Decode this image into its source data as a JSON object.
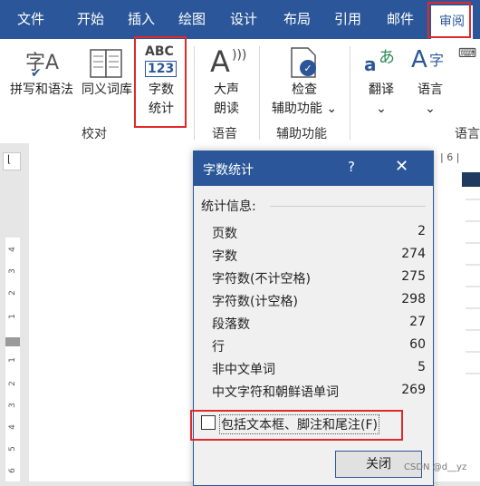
{
  "tabs": [
    {
      "label": "文件",
      "active": false
    },
    {
      "label": "开始",
      "active": false
    },
    {
      "label": "插入",
      "active": false
    },
    {
      "label": "绘图",
      "active": false
    },
    {
      "label": "设计",
      "active": false
    },
    {
      "label": "布局",
      "active": false
    },
    {
      "label": "引用",
      "active": false
    },
    {
      "label": "邮件",
      "active": false
    },
    {
      "label": "审阅",
      "active": true
    }
  ],
  "ribbon": {
    "spelling": "拼写和语法",
    "thesaurus": "同义词库",
    "wordcount_line1": "字数",
    "wordcount_line2": "统计",
    "wordcount_icon_top": "ABC",
    "wordcount_icon_bottom": "123",
    "spelling_icon": "字A",
    "readaloud_line1": "大声",
    "readaloud_line2": "朗读",
    "check_line1": "检查",
    "check_line2": "辅助功能",
    "translate": "翻译",
    "language": "语言",
    "group_proofing": "校对",
    "group_speech": "语音",
    "group_accessibility": "辅助功能",
    "group_language": "语言",
    "translate_icon": "あ",
    "language_icon": "字"
  },
  "dialog": {
    "title": "字数统计",
    "help": "?",
    "close_x": "✕",
    "stats_header": "统计信息:",
    "stats": [
      {
        "label": "页数",
        "value": "2"
      },
      {
        "label": "字数",
        "value": "274"
      },
      {
        "label": "字符数(不计空格)",
        "value": "275"
      },
      {
        "label": "字符数(计空格)",
        "value": "298"
      },
      {
        "label": "段落数",
        "value": "27"
      },
      {
        "label": "行",
        "value": "60"
      },
      {
        "label": "非中文单词",
        "value": "5"
      },
      {
        "label": "中文字符和朝鲜语单词",
        "value": "269"
      }
    ],
    "checkbox_label": "包括文本框、脚注和尾注(F)",
    "checkbox_checked": false,
    "close_button": "关闭"
  },
  "ruler": {
    "horizontal": "| 6 |",
    "vertical_ticks": [
      "4",
      "3",
      "2",
      "1",
      "1",
      "2",
      "3",
      "4",
      "5",
      "6"
    ]
  },
  "watermark": "CSDN @d__yz",
  "colors": {
    "accent": "#2b579a",
    "highlight": "#e02a2a"
  }
}
